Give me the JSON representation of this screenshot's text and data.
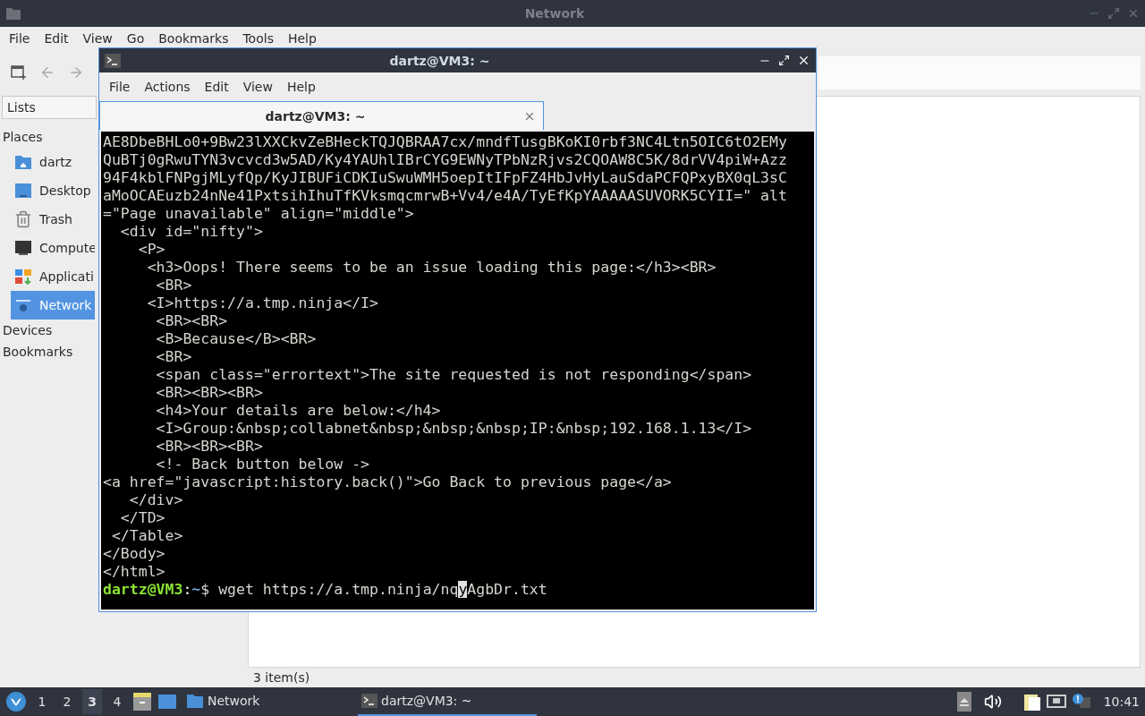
{
  "file_manager": {
    "title": "Network",
    "menu": [
      "File",
      "Edit",
      "View",
      "Go",
      "Bookmarks",
      "Tools",
      "Help"
    ],
    "side_pane_mode": "Lists",
    "sidebar": [
      {
        "title": "Places",
        "items": [
          {
            "label": "dartz",
            "kind": "home",
            "selected": false
          },
          {
            "label": "Desktop",
            "kind": "desktop",
            "selected": false
          },
          {
            "label": "Trash",
            "kind": "trash",
            "selected": false
          },
          {
            "label": "Compute",
            "kind": "computer",
            "selected": false
          },
          {
            "label": "Applicati",
            "kind": "applications",
            "selected": false
          },
          {
            "label": "Network",
            "kind": "network",
            "selected": true
          }
        ]
      },
      {
        "title": "Devices"
      },
      {
        "title": "Bookmarks"
      }
    ],
    "status_bar": "3 item(s)"
  },
  "terminal": {
    "title": "dartz@VM3: ~",
    "menu": [
      "File",
      "Actions",
      "Edit",
      "View",
      "Help"
    ],
    "tabs": [
      {
        "label": "dartz@VM3: ~",
        "selected": true
      }
    ],
    "lines": [
      "AE8DbeBHLo0+9Bw23lXXCkvZeBHeckTQJQBRAA7cx/mndfTusgBKoKI0rbf3NC4Ltn5OIC6tO2EMy",
      "QuBTj0gRwuTYN3vcvcd3w5AD/Ky4YAUhlIBrCYG9EWNyTPbNzRjvs2CQOAW8C5K/8drVV4piW+Azz",
      "94F4kblFNPgjMLyfQp/KyJIBUFiCDKIuSwuWMH5oepItIFpFZ4HbJvHyLauSdaPCFQPxyBX0qL3sC",
      "aMoOCAEuzb24nNe41PxtsihIhuTfKVksmqcmrwB+Vv4/e4A/TyEfKpYAAAAASUVORK5CYII=\" alt",
      "=\"Page unavailable\" align=\"middle\">",
      "  <div id=\"nifty\">",
      "    <P>",
      "     <h3>Oops! There seems to be an issue loading this page:</h3><BR>",
      "      <BR>",
      "     <I>https://a.tmp.ninja</I>",
      "      <BR><BR>",
      "      <B>Because</B><BR>",
      "      <BR>",
      "      <span class=\"errortext\">The site requested is not responding</span>",
      "      <BR><BR><BR>",
      "      <h4>Your details are below:</h4>",
      "      <I>Group:&nbsp;collabnet&nbsp;&nbsp;&nbsp;IP:&nbsp;192.168.1.13</I>",
      "      <BR><BR><BR>",
      "      <!- Back button below ->",
      "<a href=\"javascript:history.back()\">Go Back to previous page</a>",
      "   </div>",
      "  </TD>",
      " </Table>",
      "</Body>",
      "</html>"
    ],
    "prompt": {
      "user": "dartz@VM3",
      "separator": ":",
      "path": "~",
      "sign": "$",
      "before_cursor": "wget https://a.tmp.ninja/nq",
      "at_cursor": "y",
      "after_cursor": "AgbDr.txt"
    }
  },
  "taskbar": {
    "workspaces": [
      {
        "label": "1",
        "selected": false
      },
      {
        "label": "2",
        "selected": false
      },
      {
        "label": "3",
        "selected": true
      },
      {
        "label": "4",
        "selected": false
      }
    ],
    "tasks": [
      {
        "label": "Network",
        "kind": "folder",
        "selected": false
      },
      {
        "label": "dartz@VM3: ~",
        "kind": "terminal",
        "selected": true
      }
    ],
    "clock": "10:41"
  }
}
